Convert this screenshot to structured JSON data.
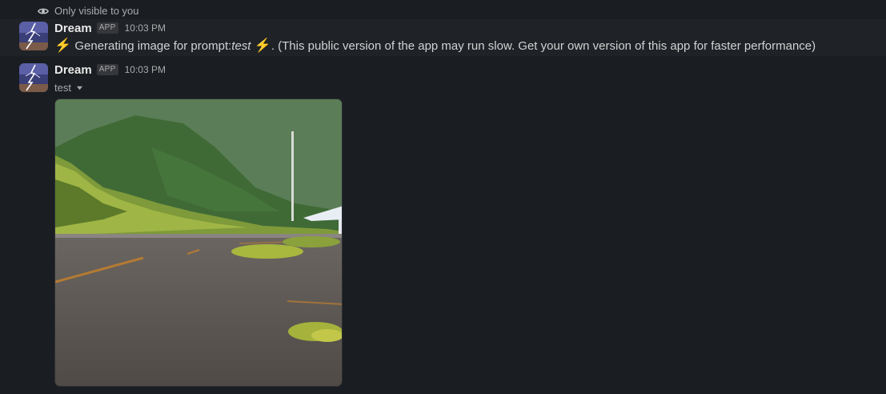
{
  "ephemeral": {
    "label": "Only visible to you",
    "icon": "eye-icon"
  },
  "messages": [
    {
      "sender": "Dream",
      "badge": "APP",
      "time": "10:03 PM",
      "text_bolt": "⚡",
      "text_before": "Generating image for prompt: ",
      "prompt": "test",
      "text_after": ". (This public version of the app may run slow. Get your own version of this app for faster performance)"
    },
    {
      "sender": "Dream",
      "badge": "APP",
      "time": "10:03 PM",
      "image_title": "test"
    }
  ],
  "icons": {
    "avatar": "lightning-storm-avatar",
    "caret": "caret-down-icon"
  },
  "colors": {
    "background": "#1a1d21",
    "highlighted_row": "#1f2226",
    "text": "#d1d2d3",
    "muted": "#ababad",
    "bolt": "#f4c12f"
  }
}
